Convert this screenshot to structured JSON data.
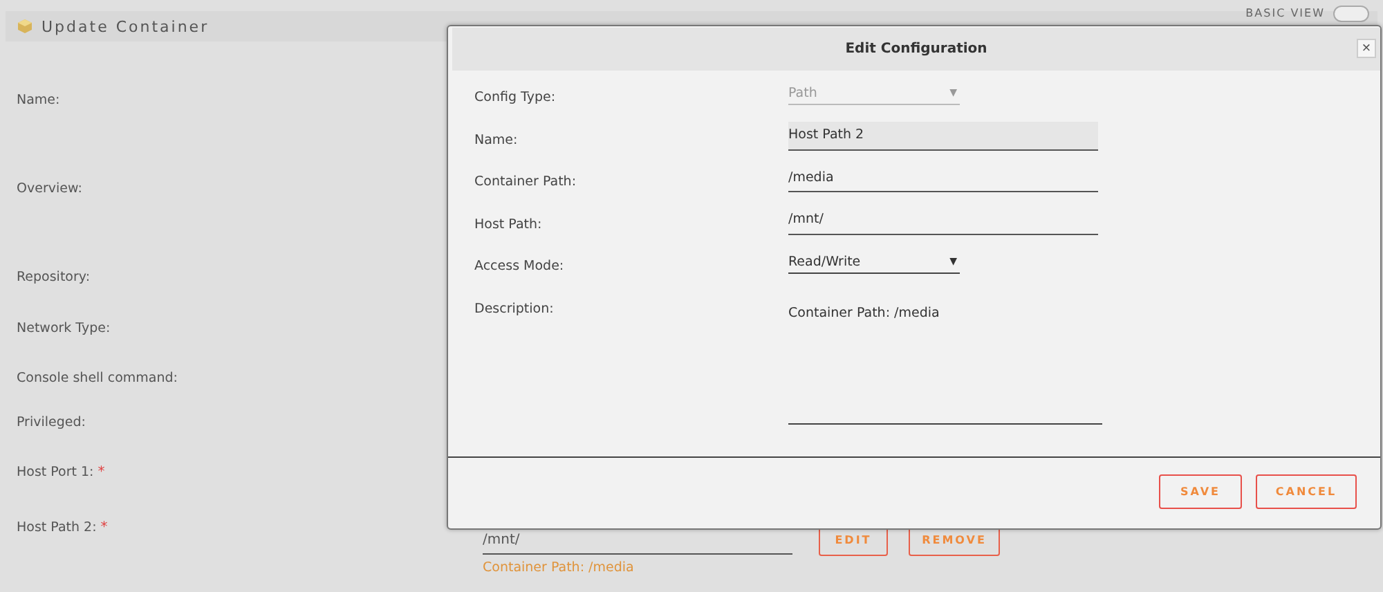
{
  "page": {
    "title": "Update Container",
    "view_toggle": {
      "label": "BASIC VIEW",
      "on": false
    }
  },
  "form": {
    "rows": [
      {
        "label": "Name:"
      },
      {
        "label": "Overview:"
      },
      {
        "label": "Repository:"
      },
      {
        "label": "Network Type:"
      },
      {
        "label": "Console shell command:"
      },
      {
        "label": "Privileged:"
      },
      {
        "label": "Host Port 1:",
        "mark": "*"
      },
      {
        "label": "Host Path 2:",
        "mark": "*",
        "value": "/mnt/",
        "description": "Container Path: /media",
        "buttons": [
          "EDIT",
          "REMOVE"
        ]
      }
    ]
  },
  "dialog": {
    "title": "Edit Configuration",
    "close": "×",
    "fields": [
      {
        "kind": "select",
        "label": "Config Type:",
        "value": "Path",
        "disabled": true,
        "arrow": "▼"
      },
      {
        "kind": "input",
        "label": "Name:",
        "value": "Host Path 2",
        "focused": true
      },
      {
        "kind": "input",
        "label": "Container Path:",
        "value": "/media",
        "focused": false
      },
      {
        "kind": "input",
        "label": "Host Path:",
        "value": "/mnt/",
        "focused": false
      },
      {
        "kind": "select",
        "label": "Access Mode:",
        "value": "Read/Write",
        "disabled": false,
        "arrow": "▼"
      },
      {
        "kind": "textarea",
        "label": "Description:",
        "value": "Container Path: /media"
      }
    ],
    "buttons": [
      "SAVE",
      "CANCEL"
    ]
  }
}
